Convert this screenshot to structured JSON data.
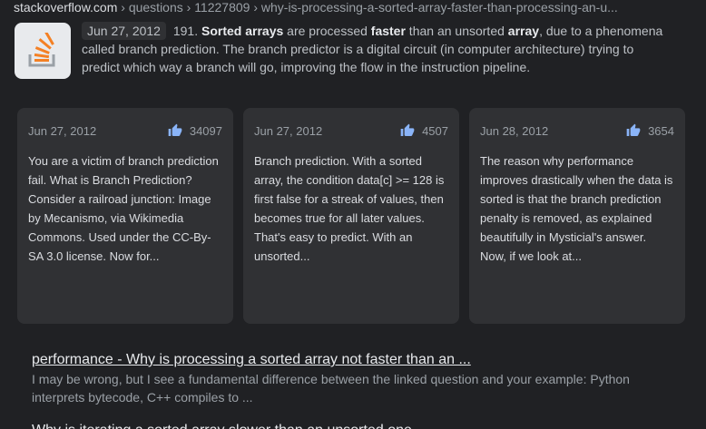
{
  "breadcrumb": {
    "domain": "stackoverflow.com",
    "path": " › questions › 11227809 › why-is-processing-a-sorted-array-faster-than-processing-an-u..."
  },
  "favicon": {
    "icon": "stackoverflow-logo-icon"
  },
  "snippet": {
    "date": "Jun 27, 2012",
    "votes_prefix": "191.",
    "bold1": "Sorted arrays",
    "t1": " are processed ",
    "bold2": "faster",
    "t2": " than an unsorted ",
    "bold3": "array",
    "t3": ", due to a phenomena called branch prediction. The branch predictor is a digital circuit (in computer architecture) trying to predict which way a branch will go, improving the flow in the instruction pipeline."
  },
  "cards": [
    {
      "date": "Jun 27, 2012",
      "votes": "34097",
      "text": "You are a victim of branch prediction fail. What is Branch Prediction? Consider a railroad junction: Image by Mecanismo, via Wikimedia Commons. Used under the CC-By-SA 3.0 license. Now for..."
    },
    {
      "date": "Jun 27, 2012",
      "votes": "4507",
      "text": "Branch prediction. With a sorted array, the condition data[c] >= 128 is first false for a streak of values, then becomes true for all later values. That's easy to predict. With an unsorted..."
    },
    {
      "date": "Jun 28, 2012",
      "votes": "3654",
      "text": "The reason why performance improves drastically when the data is sorted is that the branch prediction penalty is removed, as explained beautifully in Mysticial's answer. Now, if we look at..."
    }
  ],
  "result2": {
    "title": "performance - Why is processing a sorted array not faster than an ...",
    "desc": "I may be wrong, but I see a fundamental difference between the linked question and your example: Python interprets bytecode, C++ compiles to ..."
  },
  "result3": {
    "title": "Why is iterating a sorted array slower than an unsorted one..."
  },
  "colors": {
    "background": "#202124",
    "card": "#303134",
    "thumb": "#8ab4f8",
    "favicon_orange": "#f48024"
  }
}
